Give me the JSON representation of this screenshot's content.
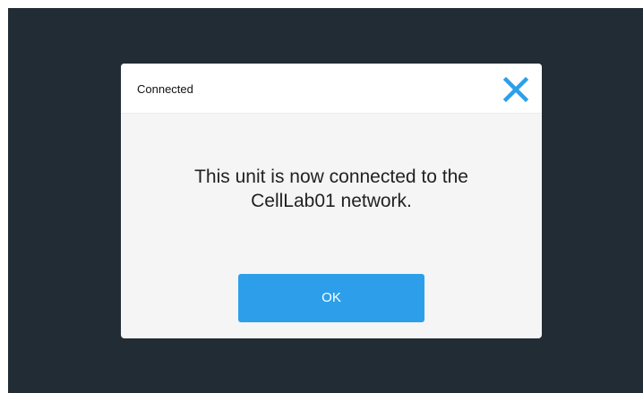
{
  "dialog": {
    "title": "Connected",
    "message_line1": "This unit is now connected to the",
    "message_line2": "CellLab01 network.",
    "ok_label": "OK",
    "close_icon": "close-icon"
  },
  "colors": {
    "screen_background": "#222c35",
    "dialog_background": "#f5f5f5",
    "header_background": "#ffffff",
    "accent": "#2d9fea",
    "close_icon": "#2d9fea"
  }
}
